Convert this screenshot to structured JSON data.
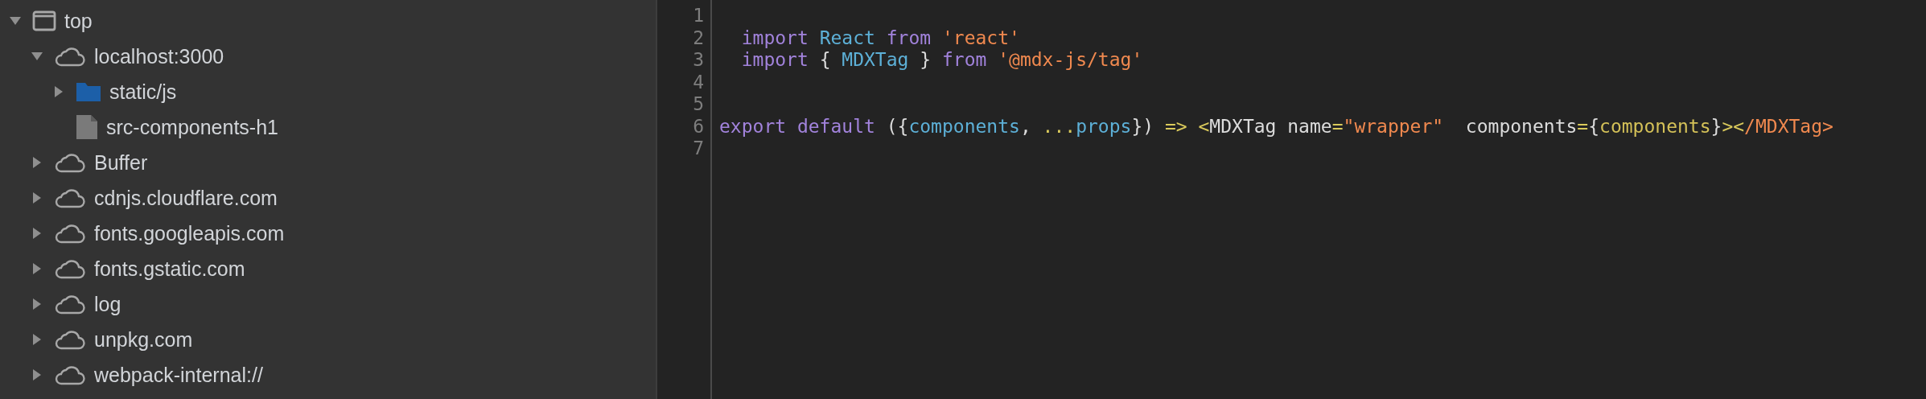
{
  "navigator": {
    "tree": [
      {
        "label": "top",
        "kind": "frame",
        "expanded": true,
        "children": [
          {
            "label": "localhost:3000",
            "kind": "domain",
            "expanded": true,
            "children": [
              {
                "label": "static/js",
                "kind": "folder",
                "expanded": false
              },
              {
                "label": "src-components-h1",
                "kind": "file"
              }
            ]
          },
          {
            "label": "Buffer",
            "kind": "domain",
            "expanded": false
          },
          {
            "label": "cdnjs.cloudflare.com",
            "kind": "domain",
            "expanded": false
          },
          {
            "label": "fonts.googleapis.com",
            "kind": "domain",
            "expanded": false
          },
          {
            "label": "fonts.gstatic.com",
            "kind": "domain",
            "expanded": false
          },
          {
            "label": "log",
            "kind": "domain",
            "expanded": false
          },
          {
            "label": "unpkg.com",
            "kind": "domain",
            "expanded": false
          },
          {
            "label": "webpack-internal://",
            "kind": "domain",
            "expanded": false
          }
        ]
      }
    ]
  },
  "editor": {
    "lines": [
      {
        "number": "1"
      },
      {
        "number": "2",
        "tokens": [
          {
            "text": "  import ",
            "kind": "keyword"
          },
          {
            "text": "React ",
            "kind": "name"
          },
          {
            "text": "from ",
            "kind": "keyword"
          },
          {
            "text": "'react'",
            "kind": "string"
          }
        ]
      },
      {
        "number": "3",
        "tokens": [
          {
            "text": "  import",
            "kind": "keyword"
          },
          {
            "text": " { ",
            "kind": "plain"
          },
          {
            "text": "MDXTag",
            "kind": "name"
          },
          {
            "text": " } ",
            "kind": "plain"
          },
          {
            "text": "from ",
            "kind": "keyword"
          },
          {
            "text": "'@mdx-js/tag'",
            "kind": "string"
          }
        ]
      },
      {
        "number": "4"
      },
      {
        "number": "5"
      },
      {
        "number": "6",
        "tokens": [
          {
            "text": "export default",
            "kind": "keyword"
          },
          {
            "text": " ({",
            "kind": "plain"
          },
          {
            "text": "components",
            "kind": "name"
          },
          {
            "text": ", ",
            "kind": "plain"
          },
          {
            "text": "...",
            "kind": "operator"
          },
          {
            "text": "props",
            "kind": "name"
          },
          {
            "text": "}) ",
            "kind": "plain"
          },
          {
            "text": "=> <",
            "kind": "operator"
          },
          {
            "text": "MDXTag name",
            "kind": "plain"
          },
          {
            "text": "=",
            "kind": "operator"
          },
          {
            "text": "\"wrapper\"",
            "kind": "string"
          },
          {
            "text": "  components",
            "kind": "plain"
          },
          {
            "text": "=",
            "kind": "operator"
          },
          {
            "text": "{",
            "kind": "plain"
          },
          {
            "text": "components",
            "kind": "value"
          },
          {
            "text": "}",
            "kind": "plain"
          },
          {
            "text": "><",
            "kind": "operator"
          },
          {
            "text": "/MDXTag>",
            "kind": "string"
          }
        ]
      },
      {
        "number": "7"
      }
    ]
  }
}
